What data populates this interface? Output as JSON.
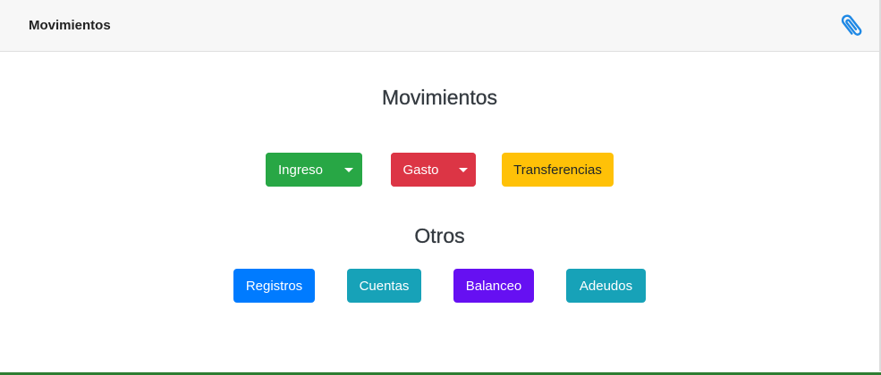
{
  "header": {
    "title": "Movimientos",
    "attach_icon": "paperclip-icon"
  },
  "main": {
    "title": "Movimientos",
    "buttons": {
      "ingreso": "Ingreso",
      "gasto": "Gasto",
      "transferencias": "Transferencias"
    }
  },
  "otros": {
    "title": "Otros",
    "buttons": {
      "registros": "Registros",
      "cuentas": "Cuentas",
      "balanceo": "Balanceo",
      "adeudos": "Adeudos"
    }
  },
  "colors": {
    "success": "#28a745",
    "danger": "#dc3545",
    "warning": "#ffc107",
    "primary": "#007bff",
    "info": "#17a2b8",
    "indigo": "#6610f2",
    "icon": "#1e88e5"
  }
}
